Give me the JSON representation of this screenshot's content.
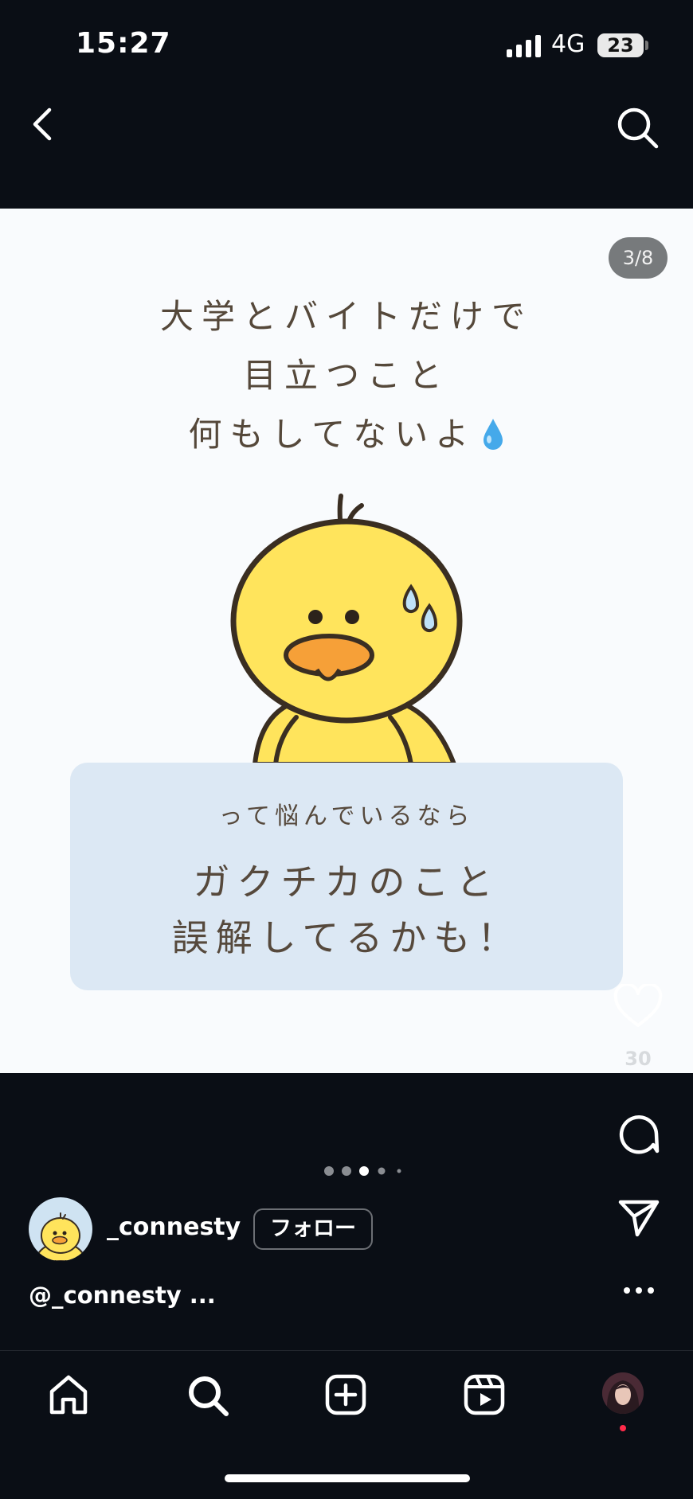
{
  "status_bar": {
    "time": "15:27",
    "network": "4G",
    "battery": "23"
  },
  "post": {
    "counter": "3/8",
    "headline_lines": [
      "大学とバイトだけで",
      "目立つこと",
      "何もしてないよ"
    ],
    "card_small": "って悩んでいるなら",
    "card_lines": [
      "ガクチカのこと",
      "誤解してるかも！"
    ]
  },
  "actions": {
    "like_count": "30"
  },
  "carousel": {
    "total": 5,
    "active": 3
  },
  "profile": {
    "username": "_connesty",
    "follow_label": "フォロー"
  },
  "caption": "@_connesty ...",
  "colors": {
    "background": "#0a0e15",
    "post_bg": "#f9fbfd",
    "card": "#dce8f4",
    "text_brown": "#55483a",
    "chick_yellow": "#ffe45c",
    "beak_orange": "#f6a038"
  }
}
